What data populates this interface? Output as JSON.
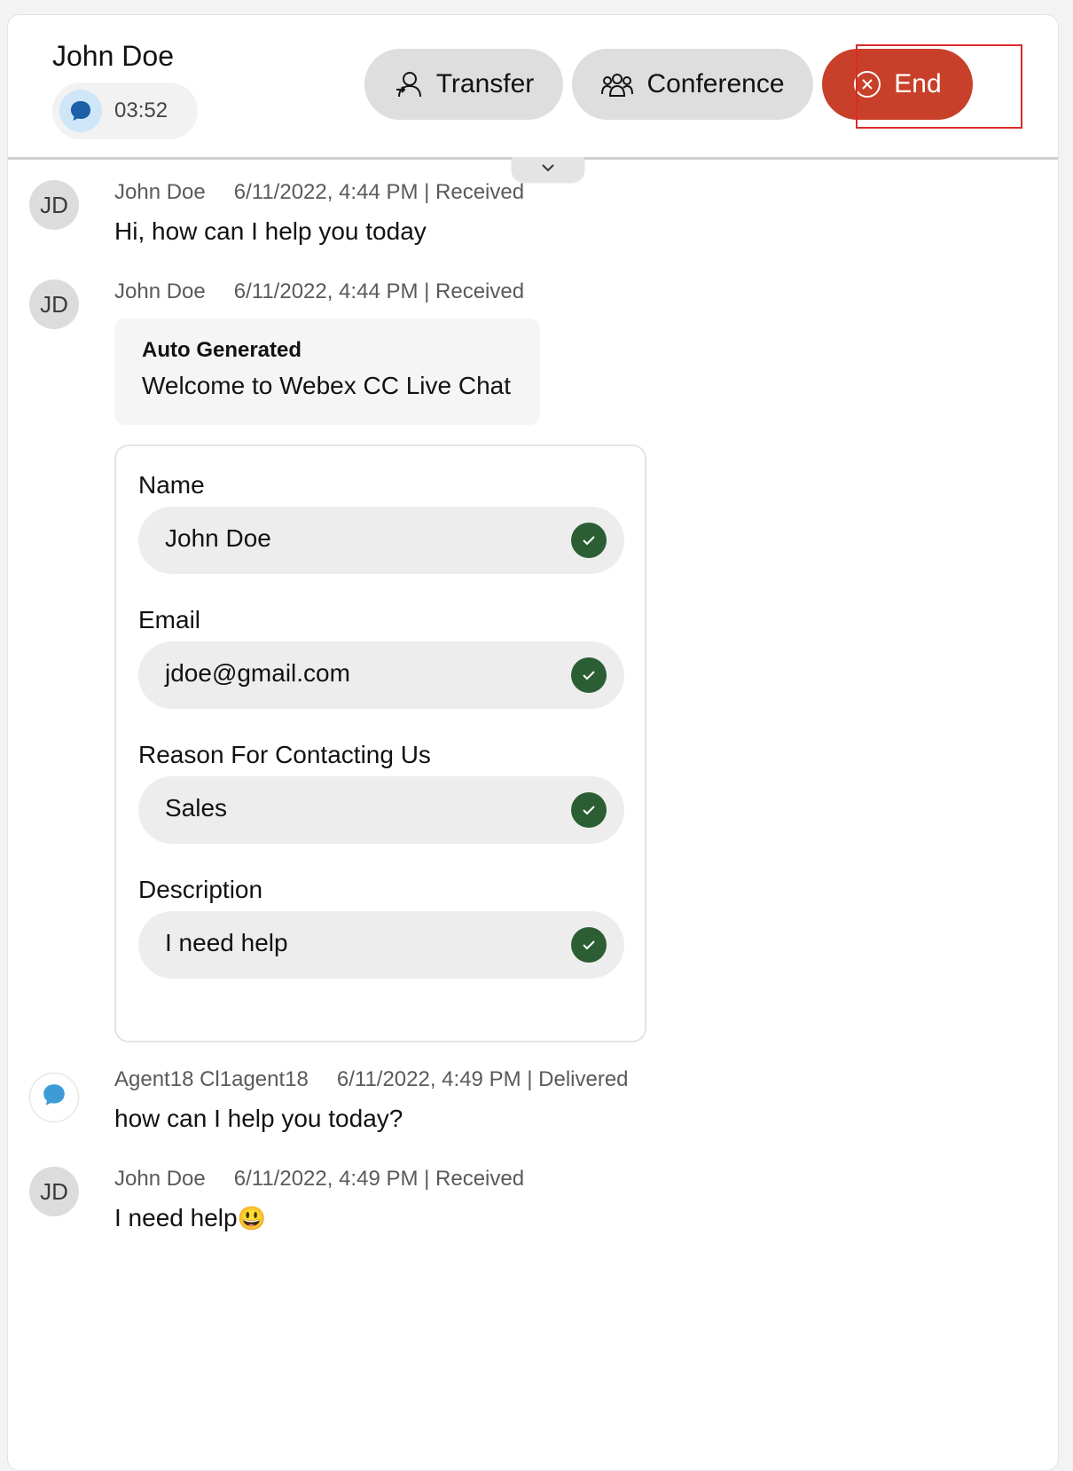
{
  "header": {
    "contact_name": "John Doe",
    "timer": "03:52",
    "buttons": {
      "transfer": "Transfer",
      "conference": "Conference",
      "end": "End"
    }
  },
  "messages": [
    {
      "avatar": "JD",
      "sender": "John Doe",
      "timestamp": "6/11/2022, 4:44 PM | Received",
      "text": "Hi, how can I help you today"
    },
    {
      "avatar": "JD",
      "sender": "John Doe",
      "timestamp": "6/11/2022, 4:44 PM | Received",
      "auto_title": "Auto Generated",
      "auto_text": "Welcome to Webex CC Live Chat"
    },
    {
      "avatar_icon": "chat-bubble-icon",
      "sender": "Agent18 Cl1agent18",
      "timestamp": "6/11/2022, 4:49 PM | Delivered",
      "text": "how can I help you today?"
    },
    {
      "avatar": "JD",
      "sender": "John Doe",
      "timestamp": "6/11/2022, 4:49 PM | Received",
      "text": "I need help",
      "emoji": "😃"
    }
  ],
  "form": {
    "fields": [
      {
        "label": "Name",
        "value": "John Doe"
      },
      {
        "label": "Email",
        "value": "jdoe@gmail.com"
      },
      {
        "label": "Reason For Contacting Us",
        "value": "Sales"
      },
      {
        "label": "Description",
        "value": "I need help"
      }
    ]
  },
  "colors": {
    "end_button": "#c8402a",
    "check_badge": "#2c5e34",
    "chat_icon": "#1d5fa8"
  }
}
